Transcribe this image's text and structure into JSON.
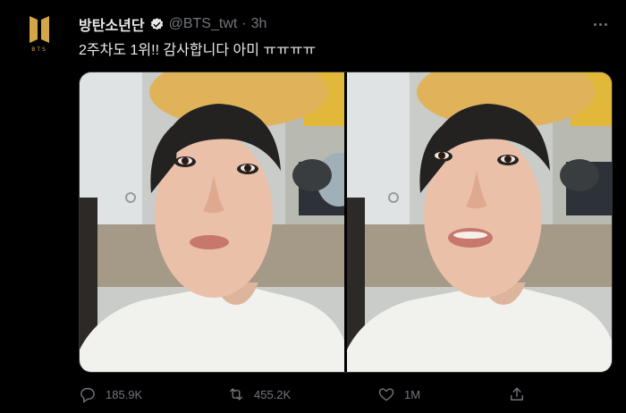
{
  "tweet": {
    "display_name": "방탄소년단",
    "handle": "@BTS_twt",
    "separator": "·",
    "time": "3h",
    "text": "2주차도 1위!! 감사합니다 아미 ㅠㅠㅠㅠ",
    "avatar_text": "BTS",
    "images": [
      {
        "alt_icon": "selfie-photo-1",
        "mouth": "closed"
      },
      {
        "alt_icon": "selfie-photo-2",
        "mouth": "open"
      }
    ],
    "stats": {
      "replies": "185.9K",
      "retweets": "455.2K",
      "likes": "1M"
    }
  },
  "colors": {
    "background": "#000000",
    "text": "#e7e9ea",
    "muted": "#71767b",
    "verified": "#e7e9ea",
    "brand_gold": "#d4a64a"
  }
}
